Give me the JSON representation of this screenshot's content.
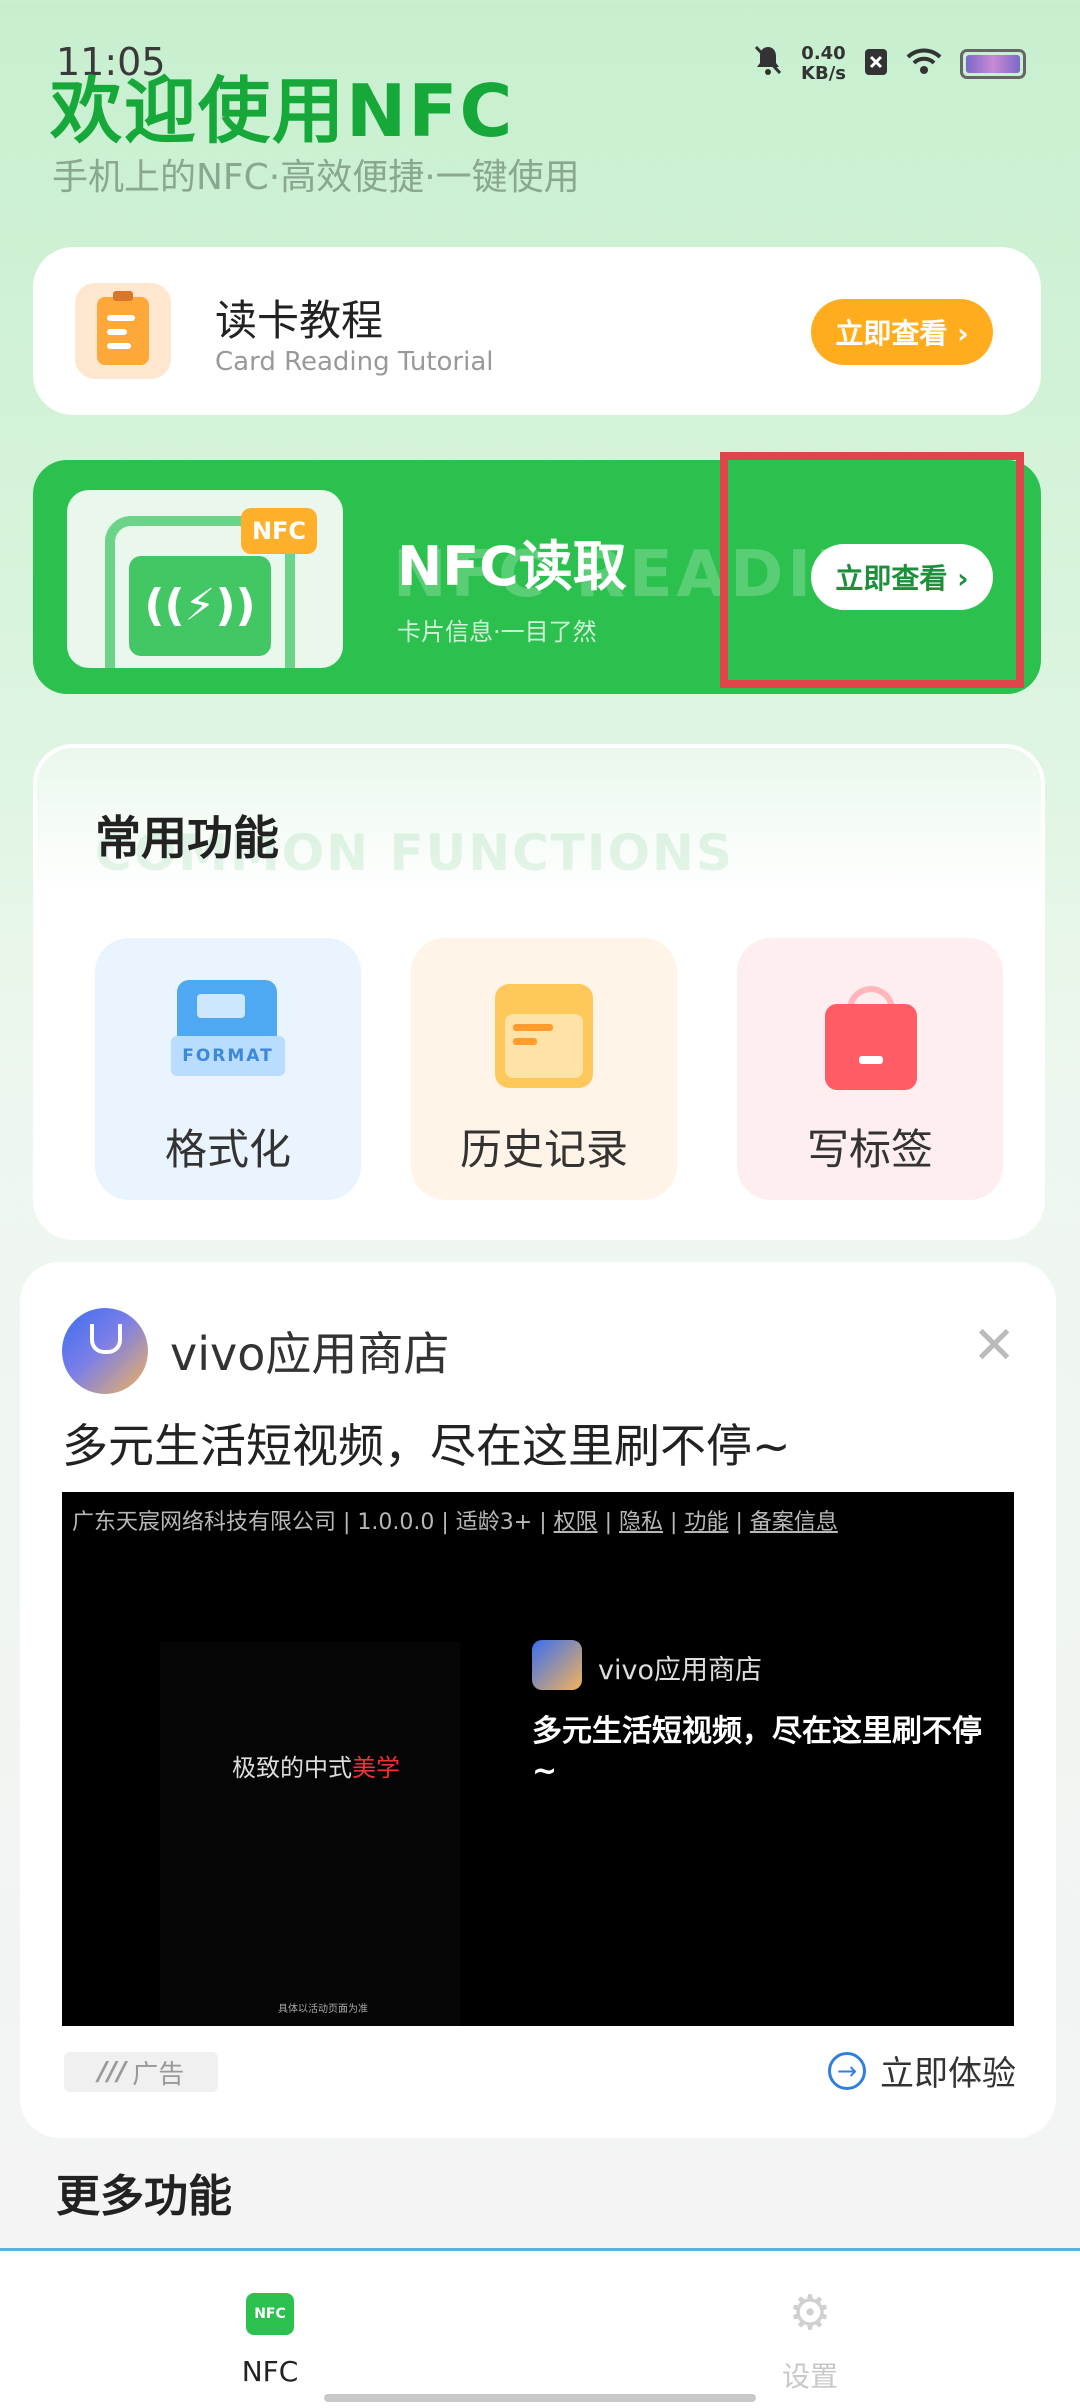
{
  "status_bar": {
    "time": "11:05",
    "net_speed_value": "0.40",
    "net_speed_unit": "KB/s"
  },
  "header": {
    "title": "欢迎使用NFC",
    "subtitle": "手机上的NFC·高效便捷·一键使用"
  },
  "tutorial_card": {
    "title": "读卡教程",
    "subtitle": "Card Reading Tutorial",
    "button_label": "立即查看 ›"
  },
  "nfc_card": {
    "tag": "NFC",
    "title": "NFC读取",
    "watermark": "NFC READING",
    "subtitle": "卡片信息·一目了然",
    "button_label": "立即查看 ›"
  },
  "common_functions": {
    "title": "常用功能",
    "watermark": "COMMON FUNCTIONS",
    "items": [
      {
        "label": "格式化",
        "icon": "format-icon",
        "icon_text": "FORMAT"
      },
      {
        "label": "历史记录",
        "icon": "history-folder-icon"
      },
      {
        "label": "写标签",
        "icon": "write-tag-bag-icon"
      }
    ]
  },
  "ad": {
    "app_name": "vivo应用商店",
    "headline": "多元生活短视频，尽在这里刷不停~",
    "meta": {
      "company": "广东天宸网络科技有限公司 | 1.0.0.0 | 适龄3+ | ",
      "link_permissions": "权限",
      "link_privacy": "隐私",
      "link_features": "功能",
      "link_filing": "备案信息",
      "sep": " | "
    },
    "video_left_text_a": "极致的中式",
    "video_left_text_b": "美学",
    "video_app_name": "vivo应用商店",
    "video_overlay_text": "多元生活短视频，尽在这里刷不停~",
    "video_tiny_text": "具体以活动页面为准",
    "badge_label": "广告",
    "cta_label": "立即体验"
  },
  "more_functions": {
    "title": "更多功能"
  },
  "bottom_nav": {
    "items": [
      {
        "label": "NFC",
        "icon": "nfc-icon",
        "active": true
      },
      {
        "label": "设置",
        "icon": "gear-icon",
        "active": false
      }
    ],
    "nfc_icon_text": "NFC"
  },
  "colors": {
    "brand_green": "#2cc14f",
    "title_green": "#17a83a",
    "orange": "#ffad1e",
    "highlight_red": "#e0454c"
  }
}
